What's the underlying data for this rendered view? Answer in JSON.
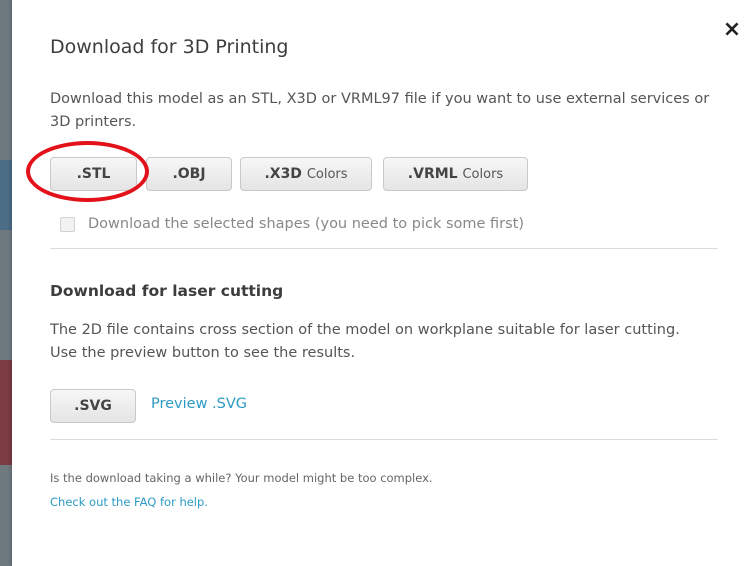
{
  "dialog": {
    "close_label": "×",
    "title": "Download for 3D Printing",
    "description": "Download this model as an STL, X3D or VRML97 file if you want to use external services or 3D printers.",
    "print_buttons": {
      "stl": ".STL",
      "obj": ".OBJ",
      "x3d_main": ".X3D",
      "x3d_sub": "Colors",
      "vrml_main": ".VRML",
      "vrml_sub": "Colors"
    },
    "selected_shapes_label": "Download the selected shapes (you need to pick some first)",
    "laser": {
      "title": "Download for laser cutting",
      "description": "The 2D file contains cross section of the model on workplane suitable for laser cutting. Use the preview button to see the results.",
      "svg_button": ".SVG",
      "preview_link": "Preview .SVG"
    },
    "footer": {
      "note": "Is the download taking a while? Your model might be too complex.",
      "faq_link": "Check out the FAQ for help."
    }
  },
  "colors": {
    "link": "#2b9bc3",
    "highlight_ring": "#e3121a"
  }
}
